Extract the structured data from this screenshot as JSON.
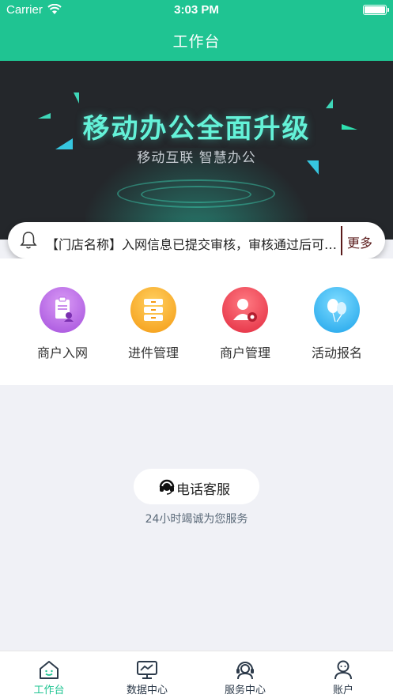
{
  "status_bar": {
    "carrier": "Carrier",
    "time": "3:03 PM"
  },
  "nav": {
    "title": "工作台"
  },
  "banner": {
    "title": "移动办公全面升级",
    "subtitle": "移动互联  智慧办公"
  },
  "notice": {
    "text": "【门店名称】入网信息已提交审核，审核通过后可正常使用",
    "more_label": "更多"
  },
  "grid": {
    "items": [
      {
        "label": "商户入网",
        "icon": "clipboard-user-icon",
        "color": "#b968e6"
      },
      {
        "label": "进件管理",
        "icon": "drawers-icon",
        "color": "#f8a823"
      },
      {
        "label": "商户管理",
        "icon": "user-gear-icon",
        "color": "#ef4456"
      },
      {
        "label": "活动报名",
        "icon": "balloons-icon",
        "color": "#2fb3f2"
      }
    ]
  },
  "support": {
    "label": "电话客服",
    "subtitle": "24小时竭诚为您服务"
  },
  "tabbar": {
    "active_color": "#1fc492",
    "items": [
      {
        "label": "工作台",
        "icon": "home-icon"
      },
      {
        "label": "数据中心",
        "icon": "monitor-chart-icon"
      },
      {
        "label": "服务中心",
        "icon": "headset-service-icon"
      },
      {
        "label": "账户",
        "icon": "user-account-icon"
      }
    ]
  }
}
